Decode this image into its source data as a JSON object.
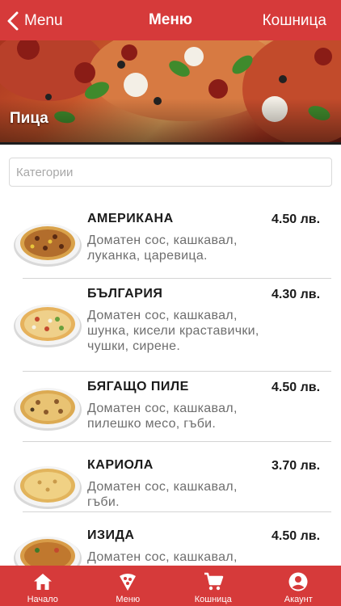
{
  "header": {
    "back_label": "Menu",
    "title": "Меню",
    "cart_label": "Кошница"
  },
  "hero": {
    "category_title": "Пица"
  },
  "search": {
    "placeholder": "Категории"
  },
  "items": [
    {
      "name": "АМЕРИКАНА",
      "description": "Доматен сос, кашкавал, луканка, царевица.",
      "price": "4.50 лв."
    },
    {
      "name": "БЪЛГАРИЯ",
      "description": "Доматен сос, кашкавал, шунка, кисели краставички, чушки, сирене.",
      "price": "4.30 лв."
    },
    {
      "name": "БЯГАЩО ПИЛЕ",
      "description": "Доматен сос, кашкавал, пилешко месо, гъби.",
      "price": "4.50 лв."
    },
    {
      "name": "КАРИОЛА",
      "description": "Доматен сос, кашкавал, гъби.",
      "price": "3.70 лв."
    },
    {
      "name": "ИЗИДА",
      "description": "Доматен сос, кашкавал,",
      "price": "4.50 лв."
    }
  ],
  "tabs": [
    {
      "label": "Начало",
      "icon": "home-icon"
    },
    {
      "label": "Меню",
      "icon": "pizza-slice-icon"
    },
    {
      "label": "Кошница",
      "icon": "cart-icon"
    },
    {
      "label": "Акаунт",
      "icon": "account-icon"
    }
  ],
  "colors": {
    "brand": "#d63a3a",
    "text": "#1a1a1a",
    "muted": "#6e6e6e",
    "divider": "#d4d4d4"
  }
}
